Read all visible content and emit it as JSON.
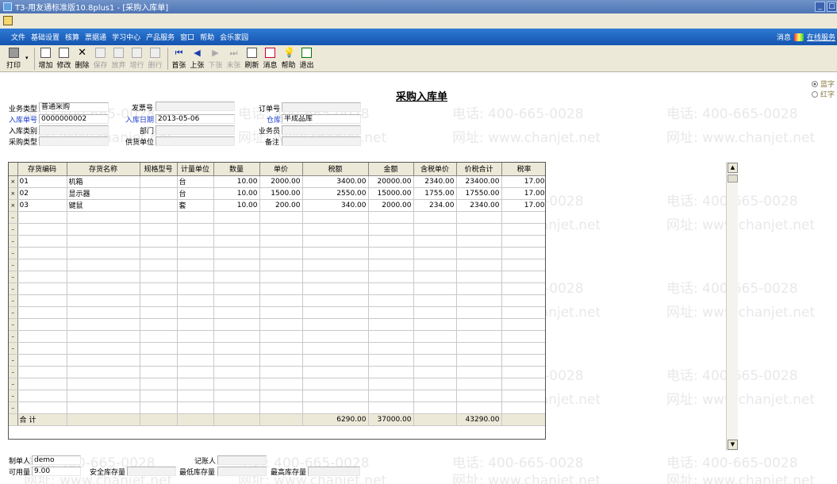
{
  "window": {
    "title": "T3-用友通标准版10.8plus1 - [采购入库单]",
    "controls": [
      "_",
      "□"
    ]
  },
  "menu": {
    "items": [
      "文件",
      "基础设置",
      "核算",
      "票据通",
      "学习中心",
      "产品服务",
      "窗口",
      "帮助",
      "会乐家园"
    ],
    "right_msg": "消息",
    "right_online": "在线服务"
  },
  "toolbar": {
    "print": "打印",
    "buttons": [
      {
        "label": "增加",
        "icon": "add-icon",
        "enabled": true
      },
      {
        "label": "修改",
        "icon": "edit-icon",
        "enabled": true
      },
      {
        "label": "删除",
        "icon": "delete-icon",
        "enabled": true
      },
      {
        "label": "保存",
        "icon": "save-icon",
        "enabled": false
      },
      {
        "label": "放弃",
        "icon": "discard-icon",
        "enabled": false
      },
      {
        "label": "增行",
        "icon": "add-row-icon",
        "enabled": false
      },
      {
        "label": "删行",
        "icon": "delete-row-icon",
        "enabled": false
      },
      {
        "label": "首张",
        "icon": "first-icon",
        "enabled": true
      },
      {
        "label": "上张",
        "icon": "prev-icon",
        "enabled": true
      },
      {
        "label": "下张",
        "icon": "next-icon",
        "enabled": false
      },
      {
        "label": "末张",
        "icon": "last-icon",
        "enabled": false
      },
      {
        "label": "刷新",
        "icon": "refresh-icon",
        "enabled": true
      },
      {
        "label": "消息",
        "icon": "message-icon",
        "enabled": true
      },
      {
        "label": "帮助",
        "icon": "help-icon",
        "enabled": true
      },
      {
        "label": "退出",
        "icon": "exit-icon",
        "enabled": true
      }
    ]
  },
  "form": {
    "title": "采购入库单",
    "radio_blue": "蓝字",
    "radio_red": "红字",
    "business_type_label": "业务类型",
    "business_type": "普通采购",
    "invoice_no_label": "发票号",
    "invoice_no": "",
    "order_no_label": "订单号",
    "order_no": "",
    "receipt_no_label": "入库单号",
    "receipt_no": "0000000002",
    "receipt_date_label": "入库日期",
    "receipt_date": "2013-05-06",
    "warehouse_label": "仓库",
    "warehouse": "半成品库",
    "receipt_category_label": "入库类别",
    "receipt_category": "",
    "department_label": "部门",
    "department": "",
    "salesman_label": "业务员",
    "salesman": "",
    "purchase_type_label": "采购类型",
    "purchase_type": "",
    "supplier_label": "供货单位",
    "supplier": "",
    "remark_label": "备注",
    "remark": ""
  },
  "grid": {
    "columns": [
      "存货编码",
      "存货名称",
      "规格型号",
      "计量单位",
      "数量",
      "单价",
      "税额",
      "金额",
      "含税单价",
      "价税合计",
      "税率"
    ],
    "rows": [
      [
        "01",
        "机箱",
        "",
        "台",
        "10.00",
        "2000.00",
        "3400.00",
        "20000.00",
        "2340.00",
        "23400.00",
        "17.00"
      ],
      [
        "02",
        "显示器",
        "",
        "台",
        "10.00",
        "1500.00",
        "2550.00",
        "15000.00",
        "1755.00",
        "17550.00",
        "17.00"
      ],
      [
        "03",
        "键鼠",
        "",
        "套",
        "10.00",
        "200.00",
        "340.00",
        "2000.00",
        "234.00",
        "2340.00",
        "17.00"
      ]
    ],
    "total_label": "合  计",
    "total_tax": "6290.00",
    "total_amount": "37000.00",
    "total_sum": "43290.00"
  },
  "footer": {
    "creator_label": "制单人",
    "creator": "demo",
    "bookkeeper_label": "记账人",
    "bookkeeper": "",
    "available_label": "可用量",
    "available": "9.00",
    "safety_stock_label": "安全库存量",
    "safety_stock": "",
    "min_stock_label": "最低库存量",
    "min_stock": "",
    "max_stock_label": "最高库存量",
    "max_stock": ""
  },
  "watermark": {
    "phone": "电话: 400-665-0028",
    "site": "网址: www.chanjet.net"
  }
}
